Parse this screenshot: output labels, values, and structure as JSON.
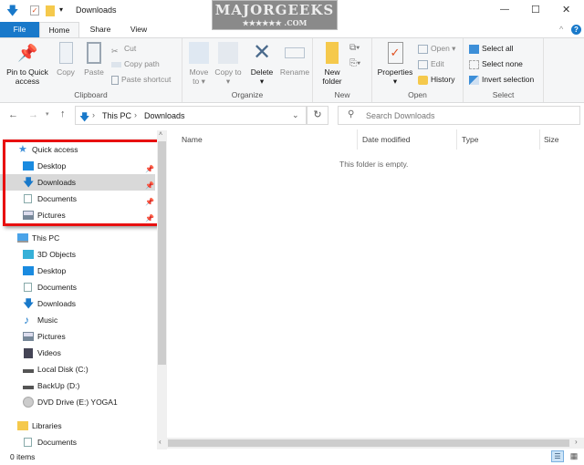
{
  "window": {
    "title": "Downloads",
    "minimize": "—",
    "maximize": "☐",
    "close": "✕",
    "help": "?",
    "collapse": "^"
  },
  "watermark": "MAJORGEEKS .COM",
  "ribbon_tabs": [
    {
      "label": "File"
    },
    {
      "label": "Home"
    },
    {
      "label": "Share"
    },
    {
      "label": "View"
    }
  ],
  "ribbon": {
    "clipboard": {
      "label": "Clipboard",
      "pin": "Pin to Quick access",
      "copy": "Copy",
      "paste": "Paste",
      "cut": "Cut",
      "copy_path": "Copy path",
      "paste_shortcut": "Paste shortcut"
    },
    "organize": {
      "label": "Organize",
      "move_to": "Move to",
      "copy_to": "Copy to",
      "delete": "Delete",
      "rename": "Rename"
    },
    "new": {
      "label": "New",
      "new_folder": "New folder"
    },
    "open": {
      "label": "Open",
      "properties": "Properties",
      "open": "Open",
      "edit": "Edit",
      "history": "History"
    },
    "select": {
      "label": "Select",
      "select_all": "Select all",
      "select_none": "Select none",
      "invert": "Invert selection"
    }
  },
  "address": {
    "crumbs": [
      "This PC",
      "Downloads"
    ],
    "search_placeholder": "Search Downloads"
  },
  "nav": {
    "quick_access": {
      "label": "Quick access",
      "items": [
        {
          "label": "Desktop"
        },
        {
          "label": "Downloads"
        },
        {
          "label": "Documents"
        },
        {
          "label": "Pictures"
        }
      ]
    },
    "this_pc": {
      "label": "This PC",
      "items": [
        {
          "label": "3D Objects"
        },
        {
          "label": "Desktop"
        },
        {
          "label": "Documents"
        },
        {
          "label": "Downloads"
        },
        {
          "label": "Music"
        },
        {
          "label": "Pictures"
        },
        {
          "label": "Videos"
        },
        {
          "label": "Local Disk (C:)"
        },
        {
          "label": "BackUp (D:)"
        },
        {
          "label": "DVD Drive (E:) YOGA1"
        }
      ]
    },
    "libraries": {
      "label": "Libraries",
      "items": [
        {
          "label": "Documents"
        }
      ]
    }
  },
  "columns": [
    "Name",
    "Date modified",
    "Type",
    "Size"
  ],
  "empty_message": "This folder is empty.",
  "status": {
    "items": "0 items"
  },
  "colors": {
    "accent": "#1979ca",
    "highlight_box": "#e81010",
    "selected": "#d9d9d9"
  }
}
